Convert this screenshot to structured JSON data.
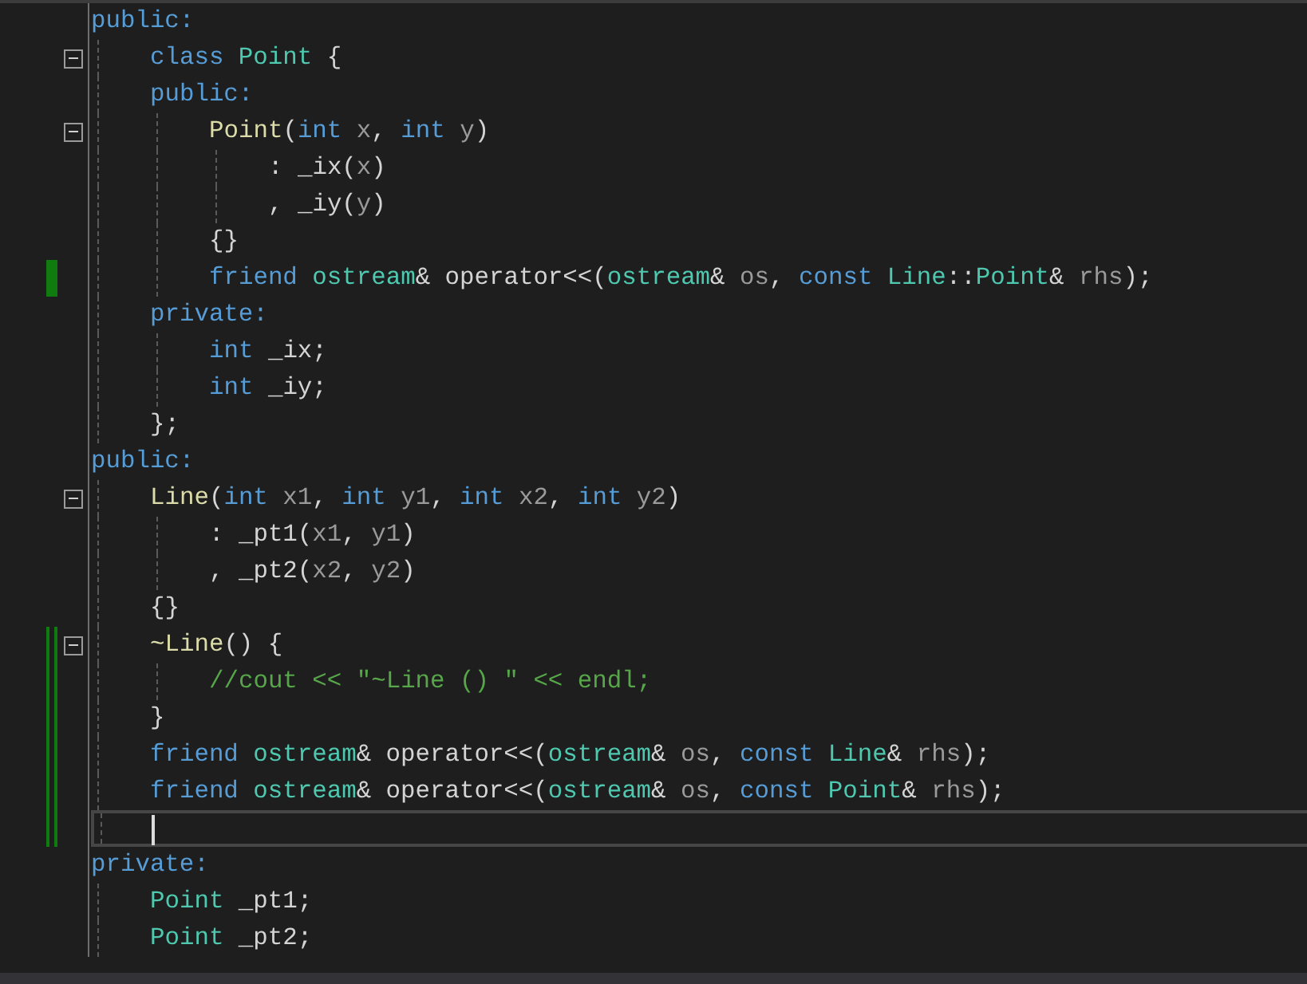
{
  "lines": [
    {
      "fold": false,
      "changed": false,
      "current": false,
      "tokens": [
        {
          "text": "public:",
          "kind": "kw"
        }
      ]
    },
    {
      "fold": true,
      "changed": false,
      "current": false,
      "tokens": [
        {
          "text": "    class",
          "kind": "kw"
        },
        {
          "text": " Point",
          "kind": "type"
        },
        {
          "text": " {",
          "kind": "plain"
        }
      ]
    },
    {
      "fold": false,
      "changed": false,
      "current": false,
      "tokens": [
        {
          "text": "    public:",
          "kind": "kw"
        }
      ]
    },
    {
      "fold": true,
      "changed": false,
      "current": false,
      "tokens": [
        {
          "text": "        Point",
          "kind": "func"
        },
        {
          "text": "(",
          "kind": "plain"
        },
        {
          "text": "int",
          "kind": "kw"
        },
        {
          "text": " x",
          "kind": "param"
        },
        {
          "text": ", ",
          "kind": "plain"
        },
        {
          "text": "int",
          "kind": "kw"
        },
        {
          "text": " y",
          "kind": "param"
        },
        {
          "text": ")",
          "kind": "plain"
        }
      ]
    },
    {
      "fold": false,
      "changed": false,
      "current": false,
      "tokens": [
        {
          "text": "            : _ix(",
          "kind": "plain"
        },
        {
          "text": "x",
          "kind": "param"
        },
        {
          "text": ")",
          "kind": "plain"
        }
      ]
    },
    {
      "fold": false,
      "changed": false,
      "current": false,
      "tokens": [
        {
          "text": "            , _iy(",
          "kind": "plain"
        },
        {
          "text": "y",
          "kind": "param"
        },
        {
          "text": ")",
          "kind": "plain"
        }
      ]
    },
    {
      "fold": false,
      "changed": false,
      "current": false,
      "tokens": [
        {
          "text": "        {}",
          "kind": "plain"
        }
      ]
    },
    {
      "fold": false,
      "changed": true,
      "saved": true,
      "current": false,
      "tokens": [
        {
          "text": "        friend",
          "kind": "kw"
        },
        {
          "text": " ostream",
          "kind": "type"
        },
        {
          "text": "& operator<<(",
          "kind": "plain"
        },
        {
          "text": "ostream",
          "kind": "type"
        },
        {
          "text": "& ",
          "kind": "plain"
        },
        {
          "text": "os",
          "kind": "param"
        },
        {
          "text": ", ",
          "kind": "plain"
        },
        {
          "text": "const",
          "kind": "kw"
        },
        {
          "text": " Line",
          "kind": "type"
        },
        {
          "text": "::",
          "kind": "plain"
        },
        {
          "text": "Point",
          "kind": "type"
        },
        {
          "text": "& ",
          "kind": "plain"
        },
        {
          "text": "rhs",
          "kind": "param"
        },
        {
          "text": ");",
          "kind": "plain"
        }
      ]
    },
    {
      "fold": false,
      "changed": false,
      "current": false,
      "tokens": [
        {
          "text": "    private:",
          "kind": "kw"
        }
      ]
    },
    {
      "fold": false,
      "changed": false,
      "current": false,
      "tokens": [
        {
          "text": "        int",
          "kind": "kw"
        },
        {
          "text": " _ix;",
          "kind": "plain"
        }
      ]
    },
    {
      "fold": false,
      "changed": false,
      "current": false,
      "tokens": [
        {
          "text": "        int",
          "kind": "kw"
        },
        {
          "text": " _iy;",
          "kind": "plain"
        }
      ]
    },
    {
      "fold": false,
      "changed": false,
      "current": false,
      "tokens": [
        {
          "text": "    };",
          "kind": "plain"
        }
      ]
    },
    {
      "fold": false,
      "changed": false,
      "current": false,
      "tokens": [
        {
          "text": "public:",
          "kind": "kw"
        }
      ]
    },
    {
      "fold": true,
      "changed": false,
      "current": false,
      "tokens": [
        {
          "text": "    Line",
          "kind": "func"
        },
        {
          "text": "(",
          "kind": "plain"
        },
        {
          "text": "int",
          "kind": "kw"
        },
        {
          "text": " x1",
          "kind": "param"
        },
        {
          "text": ", ",
          "kind": "plain"
        },
        {
          "text": "int",
          "kind": "kw"
        },
        {
          "text": " y1",
          "kind": "param"
        },
        {
          "text": ", ",
          "kind": "plain"
        },
        {
          "text": "int",
          "kind": "kw"
        },
        {
          "text": " x2",
          "kind": "param"
        },
        {
          "text": ", ",
          "kind": "plain"
        },
        {
          "text": "int",
          "kind": "kw"
        },
        {
          "text": " y2",
          "kind": "param"
        },
        {
          "text": ")",
          "kind": "plain"
        }
      ]
    },
    {
      "fold": false,
      "changed": false,
      "current": false,
      "tokens": [
        {
          "text": "        : _pt1(",
          "kind": "plain"
        },
        {
          "text": "x1",
          "kind": "param"
        },
        {
          "text": ", ",
          "kind": "plain"
        },
        {
          "text": "y1",
          "kind": "param"
        },
        {
          "text": ")",
          "kind": "plain"
        }
      ]
    },
    {
      "fold": false,
      "changed": false,
      "current": false,
      "tokens": [
        {
          "text": "        , _pt2(",
          "kind": "plain"
        },
        {
          "text": "x2",
          "kind": "param"
        },
        {
          "text": ", ",
          "kind": "plain"
        },
        {
          "text": "y2",
          "kind": "param"
        },
        {
          "text": ")",
          "kind": "plain"
        }
      ]
    },
    {
      "fold": false,
      "changed": false,
      "current": false,
      "tokens": [
        {
          "text": "    {}",
          "kind": "plain"
        }
      ]
    },
    {
      "fold": true,
      "changed": true,
      "saved": false,
      "current": false,
      "tokens": [
        {
          "text": "    ~Line",
          "kind": "func"
        },
        {
          "text": "() {",
          "kind": "plain"
        }
      ]
    },
    {
      "fold": false,
      "changed": true,
      "saved": false,
      "current": false,
      "tokens": [
        {
          "text": "        //cout << \"~Line () \" << endl;",
          "kind": "comment"
        }
      ]
    },
    {
      "fold": false,
      "changed": true,
      "saved": false,
      "current": false,
      "tokens": [
        {
          "text": "    }",
          "kind": "plain"
        }
      ]
    },
    {
      "fold": false,
      "changed": true,
      "saved": false,
      "current": false,
      "tokens": [
        {
          "text": "    friend",
          "kind": "kw"
        },
        {
          "text": " ostream",
          "kind": "type"
        },
        {
          "text": "& operator<<(",
          "kind": "plain"
        },
        {
          "text": "ostream",
          "kind": "type"
        },
        {
          "text": "& ",
          "kind": "plain"
        },
        {
          "text": "os",
          "kind": "param"
        },
        {
          "text": ", ",
          "kind": "plain"
        },
        {
          "text": "const",
          "kind": "kw"
        },
        {
          "text": " Line",
          "kind": "type"
        },
        {
          "text": "& ",
          "kind": "plain"
        },
        {
          "text": "rhs",
          "kind": "param"
        },
        {
          "text": ");",
          "kind": "plain"
        }
      ]
    },
    {
      "fold": false,
      "changed": true,
      "saved": false,
      "current": false,
      "tokens": [
        {
          "text": "    friend",
          "kind": "kw"
        },
        {
          "text": " ostream",
          "kind": "type"
        },
        {
          "text": "& operator<<(",
          "kind": "plain"
        },
        {
          "text": "ostream",
          "kind": "type"
        },
        {
          "text": "& ",
          "kind": "plain"
        },
        {
          "text": "os",
          "kind": "param"
        },
        {
          "text": ", ",
          "kind": "plain"
        },
        {
          "text": "const",
          "kind": "kw"
        },
        {
          "text": " Point",
          "kind": "type"
        },
        {
          "text": "& ",
          "kind": "plain"
        },
        {
          "text": "rhs",
          "kind": "param"
        },
        {
          "text": ");",
          "kind": "plain"
        }
      ]
    },
    {
      "fold": false,
      "changed": true,
      "saved": false,
      "current": true
    },
    {
      "fold": false,
      "changed": false,
      "current": false,
      "tokens": [
        {
          "text": "private:",
          "kind": "kw"
        }
      ]
    },
    {
      "fold": false,
      "changed": false,
      "current": false,
      "tokens": [
        {
          "text": "    Point",
          "kind": "type"
        },
        {
          "text": " _pt1;",
          "kind": "plain"
        }
      ]
    },
    {
      "fold": false,
      "changed": false,
      "current": false,
      "tokens": [
        {
          "text": "    Point",
          "kind": "type"
        },
        {
          "text": " _pt2;",
          "kind": "plain"
        }
      ]
    }
  ]
}
